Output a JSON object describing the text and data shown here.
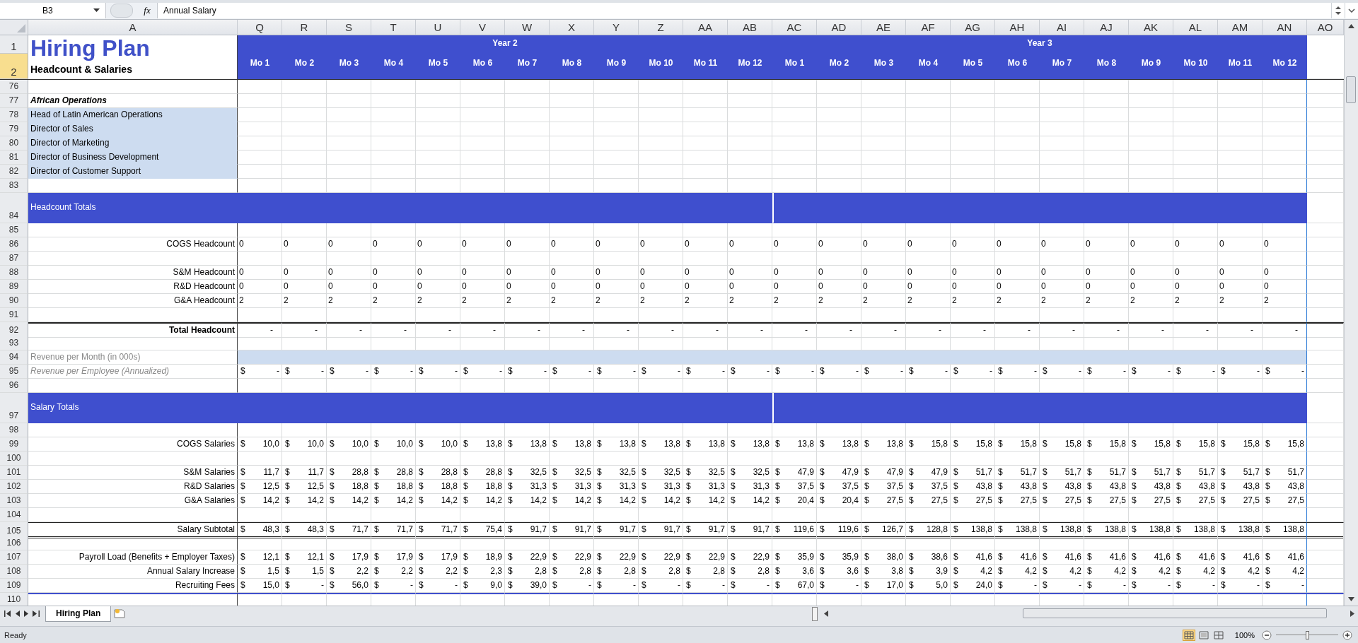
{
  "formula_bar": {
    "name_box": "B3",
    "function_label": "fx",
    "formula": "Annual Salary"
  },
  "column_headers": [
    "A",
    "Q",
    "R",
    "S",
    "T",
    "U",
    "V",
    "W",
    "X",
    "Y",
    "Z",
    "AA",
    "AB",
    "AC",
    "AD",
    "AE",
    "AF",
    "AG",
    "AH",
    "AI",
    "AJ",
    "AK",
    "AL",
    "AM",
    "AN",
    "AO"
  ],
  "title": "Hiring Plan",
  "subtitle": "Headcount & Salaries",
  "header_rows": [
    {
      "num": "1",
      "selected": false
    },
    {
      "num": "2",
      "selected": true
    }
  ],
  "years": [
    {
      "label": "Year 2",
      "months": [
        "Mo 1",
        "Mo 2",
        "Mo 3",
        "Mo 4",
        "Mo 5",
        "Mo 6",
        "Mo 7",
        "Mo 8",
        "Mo 9",
        "Mo 10",
        "Mo 11",
        "Mo 12"
      ]
    },
    {
      "label": "Year 3",
      "months": [
        "Mo 1",
        "Mo 2",
        "Mo 3",
        "Mo 4",
        "Mo 5",
        "Mo 6",
        "Mo 7",
        "Mo 8",
        "Mo 9",
        "Mo 10",
        "Mo 11",
        "Mo 12"
      ]
    }
  ],
  "rows": [
    {
      "num": "76",
      "kind": "blank"
    },
    {
      "num": "77",
      "kind": "group",
      "label": "African Operations"
    },
    {
      "num": "78",
      "kind": "role",
      "label": "Head of Latin American Operations"
    },
    {
      "num": "79",
      "kind": "role",
      "label": "Director of Sales"
    },
    {
      "num": "80",
      "kind": "role",
      "label": "Director of Marketing"
    },
    {
      "num": "81",
      "kind": "role",
      "label": "Director of Business Development"
    },
    {
      "num": "82",
      "kind": "role",
      "label": "Director of Customer Support"
    },
    {
      "num": "83",
      "kind": "blank"
    },
    {
      "num": "84",
      "kind": "band",
      "label": "Headcount Totals"
    },
    {
      "num": "85",
      "kind": "blank"
    },
    {
      "num": "86",
      "kind": "count",
      "label": "COGS Headcount",
      "values": [
        "0",
        "0",
        "0",
        "0",
        "0",
        "0",
        "0",
        "0",
        "0",
        "0",
        "0",
        "0",
        "0",
        "0",
        "0",
        "0",
        "0",
        "0",
        "0",
        "0",
        "0",
        "0",
        "0",
        "0"
      ]
    },
    {
      "num": "87",
      "kind": "blank"
    },
    {
      "num": "88",
      "kind": "count",
      "label": "S&M Headcount",
      "values": [
        "0",
        "0",
        "0",
        "0",
        "0",
        "0",
        "0",
        "0",
        "0",
        "0",
        "0",
        "0",
        "0",
        "0",
        "0",
        "0",
        "0",
        "0",
        "0",
        "0",
        "0",
        "0",
        "0",
        "0"
      ]
    },
    {
      "num": "89",
      "kind": "count",
      "label": "R&D Headcount",
      "values": [
        "0",
        "0",
        "0",
        "0",
        "0",
        "0",
        "0",
        "0",
        "0",
        "0",
        "0",
        "0",
        "0",
        "0",
        "0",
        "0",
        "0",
        "0",
        "0",
        "0",
        "0",
        "0",
        "0",
        "0"
      ]
    },
    {
      "num": "90",
      "kind": "count",
      "label": "G&A Headcount",
      "values": [
        "2",
        "2",
        "2",
        "2",
        "2",
        "2",
        "2",
        "2",
        "2",
        "2",
        "2",
        "2",
        "2",
        "2",
        "2",
        "2",
        "2",
        "2",
        "2",
        "2",
        "2",
        "2",
        "2",
        "2"
      ]
    },
    {
      "num": "91",
      "kind": "blank"
    },
    {
      "num": "92",
      "kind": "total",
      "label": "Total Headcount",
      "values": [
        "-",
        "-",
        "-",
        "-",
        "-",
        "-",
        "-",
        "-",
        "-",
        "-",
        "-",
        "-",
        "-",
        "-",
        "-",
        "-",
        "-",
        "-",
        "-",
        "-",
        "-",
        "-",
        "-",
        "-"
      ]
    },
    {
      "num": "93",
      "kind": "blank"
    },
    {
      "num": "94",
      "kind": "revenue-month",
      "label": "Revenue per Month (in 000s)"
    },
    {
      "num": "95",
      "kind": "revenue-employee",
      "label": "Revenue per Employee (Annualized)",
      "values": [
        "$ -",
        "$ -",
        "$ -",
        "$ -",
        "$ -",
        "$ -",
        "$ -",
        "$ -",
        "$ -",
        "$ -",
        "$ -",
        "$ -",
        "$ -",
        "$ -",
        "$ -",
        "$ -",
        "$ -",
        "$ -",
        "$ -",
        "$ -",
        "$ -",
        "$ -",
        "$ -",
        "$ -"
      ]
    },
    {
      "num": "96",
      "kind": "blank"
    },
    {
      "num": "97",
      "kind": "band",
      "label": "Salary Totals"
    },
    {
      "num": "98",
      "kind": "blank"
    },
    {
      "num": "99",
      "kind": "money",
      "label": "COGS Salaries",
      "values": [
        "$ 10,0",
        "$ 10,0",
        "$ 10,0",
        "$ 10,0",
        "$ 10,0",
        "$ 13,8",
        "$ 13,8",
        "$ 13,8",
        "$ 13,8",
        "$ 13,8",
        "$ 13,8",
        "$ 13,8",
        "$ 13,8",
        "$ 13,8",
        "$ 13,8",
        "$ 15,8",
        "$ 15,8",
        "$ 15,8",
        "$ 15,8",
        "$ 15,8",
        "$ 15,8",
        "$ 15,8",
        "$ 15,8",
        "$ 15,8"
      ]
    },
    {
      "num": "100",
      "kind": "blank"
    },
    {
      "num": "101",
      "kind": "money",
      "label": "S&M Salaries",
      "values": [
        "$ 11,7",
        "$ 11,7",
        "$ 28,8",
        "$ 28,8",
        "$ 28,8",
        "$ 28,8",
        "$ 32,5",
        "$ 32,5",
        "$ 32,5",
        "$ 32,5",
        "$ 32,5",
        "$ 32,5",
        "$ 47,9",
        "$ 47,9",
        "$ 47,9",
        "$ 47,9",
        "$ 51,7",
        "$ 51,7",
        "$ 51,7",
        "$ 51,7",
        "$ 51,7",
        "$ 51,7",
        "$ 51,7",
        "$ 51,7"
      ]
    },
    {
      "num": "102",
      "kind": "money",
      "label": "R&D Salaries",
      "values": [
        "$ 12,5",
        "$ 12,5",
        "$ 18,8",
        "$ 18,8",
        "$ 18,8",
        "$ 18,8",
        "$ 31,3",
        "$ 31,3",
        "$ 31,3",
        "$ 31,3",
        "$ 31,3",
        "$ 31,3",
        "$ 37,5",
        "$ 37,5",
        "$ 37,5",
        "$ 37,5",
        "$ 43,8",
        "$ 43,8",
        "$ 43,8",
        "$ 43,8",
        "$ 43,8",
        "$ 43,8",
        "$ 43,8",
        "$ 43,8"
      ]
    },
    {
      "num": "103",
      "kind": "money",
      "label": "G&A Salaries",
      "values": [
        "$ 14,2",
        "$ 14,2",
        "$ 14,2",
        "$ 14,2",
        "$ 14,2",
        "$ 14,2",
        "$ 14,2",
        "$ 14,2",
        "$ 14,2",
        "$ 14,2",
        "$ 14,2",
        "$ 14,2",
        "$ 20,4",
        "$ 20,4",
        "$ 27,5",
        "$ 27,5",
        "$ 27,5",
        "$ 27,5",
        "$ 27,5",
        "$ 27,5",
        "$ 27,5",
        "$ 27,5",
        "$ 27,5",
        "$ 27,5"
      ]
    },
    {
      "num": "104",
      "kind": "blank"
    },
    {
      "num": "105",
      "kind": "subtotal",
      "label": "Salary Subtotal",
      "values": [
        "$ 48,3",
        "$ 48,3",
        "$ 71,7",
        "$ 71,7",
        "$ 71,7",
        "$ 75,4",
        "$ 91,7",
        "$ 91,7",
        "$ 91,7",
        "$ 91,7",
        "$ 91,7",
        "$ 91,7",
        "$ 119,6",
        "$ 119,6",
        "$ 126,7",
        "$ 128,8",
        "$ 138,8",
        "$ 138,8",
        "$ 138,8",
        "$ 138,8",
        "$ 138,8",
        "$ 138,8",
        "$ 138,8",
        "$ 138,8"
      ]
    },
    {
      "num": "106",
      "kind": "blank"
    },
    {
      "num": "107",
      "kind": "money",
      "label": "Payroll Load (Benefits + Employer Taxes)",
      "values": [
        "$ 12,1",
        "$ 12,1",
        "$ 17,9",
        "$ 17,9",
        "$ 17,9",
        "$ 18,9",
        "$ 22,9",
        "$ 22,9",
        "$ 22,9",
        "$ 22,9",
        "$ 22,9",
        "$ 22,9",
        "$ 35,9",
        "$ 35,9",
        "$ 38,0",
        "$ 38,6",
        "$ 41,6",
        "$ 41,6",
        "$ 41,6",
        "$ 41,6",
        "$ 41,6",
        "$ 41,6",
        "$ 41,6",
        "$ 41,6"
      ]
    },
    {
      "num": "108",
      "kind": "money",
      "label": "Annual Salary Increase",
      "values": [
        "$ 1,5",
        "$ 1,5",
        "$ 2,2",
        "$ 2,2",
        "$ 2,2",
        "$ 2,3",
        "$ 2,8",
        "$ 2,8",
        "$ 2,8",
        "$ 2,8",
        "$ 2,8",
        "$ 2,8",
        "$ 3,6",
        "$ 3,6",
        "$ 3,8",
        "$ 3,9",
        "$ 4,2",
        "$ 4,2",
        "$ 4,2",
        "$ 4,2",
        "$ 4,2",
        "$ 4,2",
        "$ 4,2",
        "$ 4,2"
      ]
    },
    {
      "num": "109",
      "kind": "money",
      "label": "Recruiting Fees",
      "values": [
        "$ 15,0",
        "$ -",
        "$ 56,0",
        "$ -",
        "$ -",
        "$ 9,0",
        "$ 39,0",
        "$ -",
        "$ -",
        "$ -",
        "$ -",
        "$ -",
        "$ 67,0",
        "$ -",
        "$ 17,0",
        "$ 5,0",
        "$ 24,0",
        "$ -",
        "$ -",
        "$ -",
        "$ -",
        "$ -",
        "$ -",
        "$ -"
      ]
    },
    {
      "num": "110",
      "kind": "blank"
    }
  ],
  "sheet_tabs": [
    {
      "label": "Hiring Plan",
      "selected": true
    }
  ],
  "status_bar": {
    "status": "Ready",
    "views": [
      {
        "kind": "normal",
        "selected": true
      },
      {
        "kind": "page-layout",
        "selected": false
      },
      {
        "kind": "page-break",
        "selected": false
      }
    ],
    "zoom": "100%",
    "zoom_slider": {
      "level": 0.5
    }
  }
}
